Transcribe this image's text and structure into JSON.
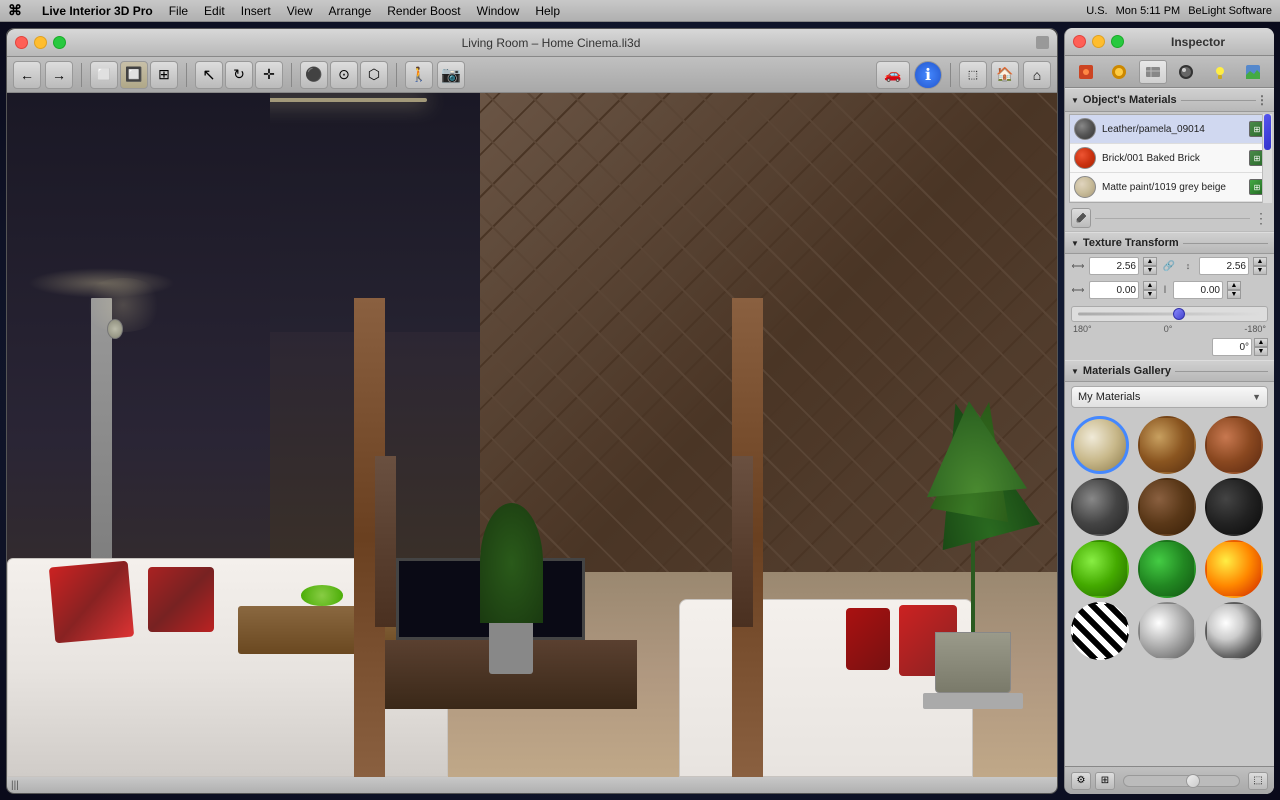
{
  "menubar": {
    "apple": "⌘",
    "items": [
      "Live Interior 3D Pro",
      "File",
      "Edit",
      "Insert",
      "View",
      "Arrange",
      "Render Boost",
      "Window",
      "Help"
    ],
    "right": {
      "status": "Mon 5:11 PM",
      "brand": "BeLight Software",
      "region": "U.S."
    }
  },
  "window": {
    "title": "Living Room – Home Cinema.li3d",
    "traffic_lights": [
      "close",
      "minimize",
      "maximize"
    ]
  },
  "toolbar": {
    "nav_back": "←",
    "nav_forward": "→",
    "btn_floor": "⬜",
    "btn_obj": "🔲",
    "btn_camera": "📷"
  },
  "inspector": {
    "title": "Inspector",
    "tabs": [
      "🔴",
      "🔵",
      "✏️",
      "⚫",
      "💡",
      "🏠"
    ],
    "objects_materials_label": "Object's Materials",
    "materials": [
      {
        "id": "leather",
        "name": "Leather/pamela_09014",
        "color": "#6a6a6a",
        "selected": true
      },
      {
        "id": "brick",
        "name": "Brick/001 Baked Brick",
        "color": "#cc4422"
      },
      {
        "id": "matte",
        "name": "Matte paint/1019 grey beige",
        "color": "#d4c8b0"
      }
    ],
    "texture_transform": {
      "label": "Texture Transform",
      "scale_x": "2.56",
      "scale_y": "2.56",
      "offset_x": "0.00",
      "offset_y": "0.00",
      "rotation_value": "0°",
      "rotation_min": "180°",
      "rotation_zero": "0°",
      "rotation_max": "-180°"
    },
    "gallery": {
      "label": "Materials Gallery",
      "dropdown_value": "My Materials",
      "materials": [
        {
          "id": "cream",
          "class": "ball-cream",
          "label": "Cream"
        },
        {
          "id": "wood",
          "class": "ball-wood",
          "label": "Wood"
        },
        {
          "id": "brick",
          "class": "ball-brick",
          "label": "Brick"
        },
        {
          "id": "metal-dark",
          "class": "ball-metal-dark",
          "label": "Dark Metal"
        },
        {
          "id": "wood-dark",
          "class": "ball-wood-dark",
          "label": "Dark Wood"
        },
        {
          "id": "black",
          "class": "ball-black",
          "label": "Black"
        },
        {
          "id": "green",
          "class": "ball-green",
          "label": "Green"
        },
        {
          "id": "green2",
          "class": "ball-green2",
          "label": "Green 2"
        },
        {
          "id": "fire",
          "class": "ball-fire",
          "label": "Fire"
        },
        {
          "id": "zebra",
          "class": "ball-zebra",
          "label": "Zebra"
        },
        {
          "id": "spots",
          "class": "ball-spots",
          "label": "Spots"
        },
        {
          "id": "chrome",
          "class": "ball-chrome",
          "label": "Chrome"
        }
      ]
    }
  },
  "viewport": {
    "scroll_indicator": "|||"
  }
}
